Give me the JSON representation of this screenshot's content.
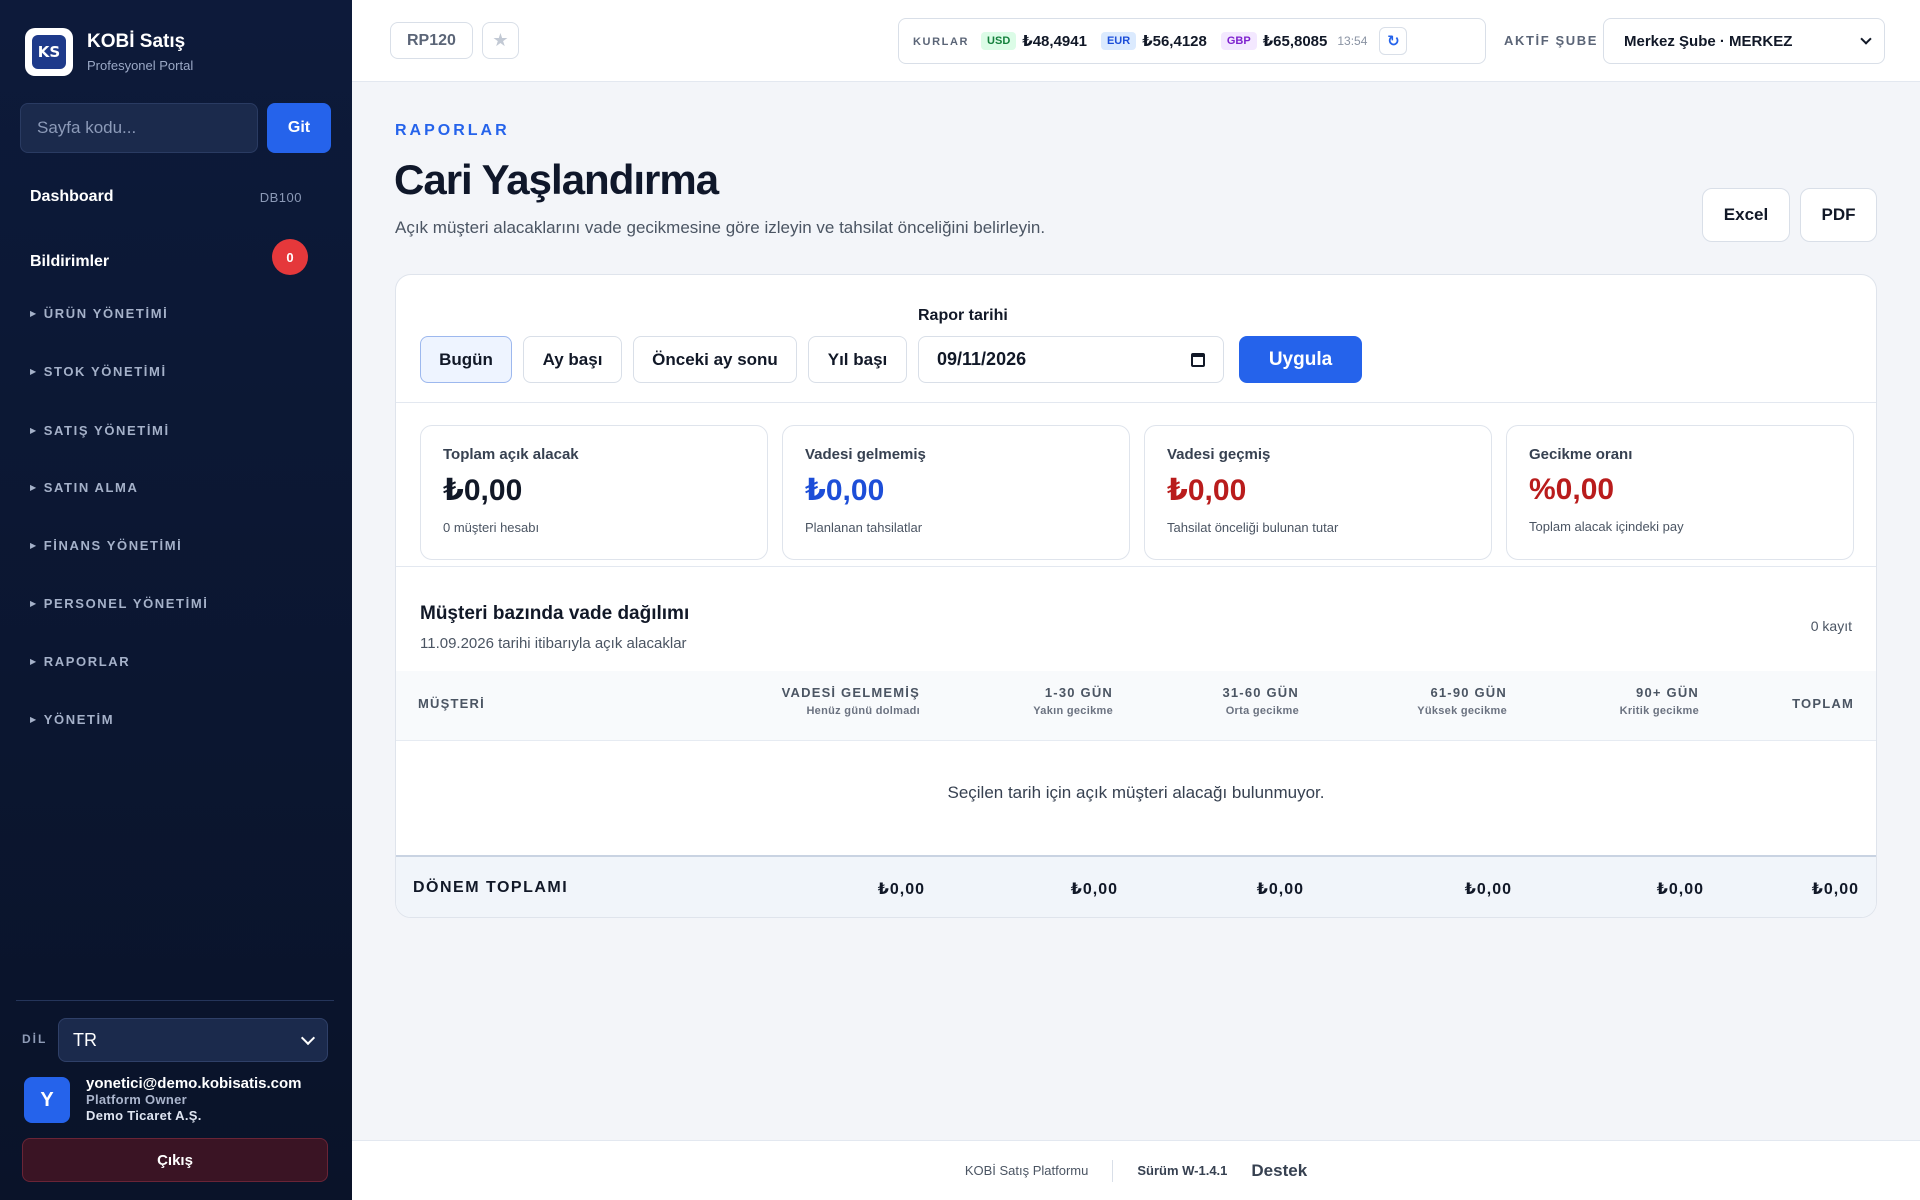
{
  "brand": {
    "name": "KOBİ Satış",
    "subtitle": "Profesyonel Portal",
    "logo_text": "KS"
  },
  "jump": {
    "placeholder": "Sayfa kodu...",
    "button": "Git"
  },
  "nav": {
    "dashboard": {
      "label": "Dashboard",
      "code": "DB100"
    },
    "notifications": {
      "label": "Bildirimler",
      "count": "0"
    },
    "groups": [
      "ÜRÜN YÖNETİMİ",
      "STOK YÖNETİMİ",
      "SATIŞ YÖNETİMİ",
      "SATIN ALMA",
      "FİNANS YÖNETİMİ",
      "PERSONEL YÖNETİMİ",
      "RAPORLAR",
      "YÖNETİM"
    ]
  },
  "lang": {
    "label": "DİL",
    "value": "TR"
  },
  "user": {
    "initial": "Y",
    "email": "yonetici@demo.kobisatis.com",
    "role": "Platform Owner",
    "company": "Demo Ticaret A.Ş."
  },
  "logout": "Çıkış",
  "topbar": {
    "page_code": "RP120",
    "rates_label": "KURLAR",
    "rates": [
      {
        "code": "USD",
        "value": "₺48,4941",
        "bg": "#dcfce7",
        "fg": "#15803d"
      },
      {
        "code": "EUR",
        "value": "₺56,4128",
        "bg": "#dbeafe",
        "fg": "#1d4ed8"
      },
      {
        "code": "GBP",
        "value": "₺65,8085",
        "bg": "#f3e8ff",
        "fg": "#7e22ce"
      }
    ],
    "rates_time": "13:54",
    "branch_label": "AKTİF ŞUBE",
    "branch_value": "Merkez Şube · MERKEZ"
  },
  "page": {
    "eyebrow": "RAPORLAR",
    "title": "Cari Yaşlandırma",
    "description": "Açık müşteri alacaklarını vade gecikmesine göre izleyin ve tahsilat önceliğini belirleyin.",
    "export_excel": "Excel",
    "export_pdf": "PDF"
  },
  "filters": {
    "quick": [
      "Bugün",
      "Ay başı",
      "Önceki ay sonu",
      "Yıl başı"
    ],
    "active_index": 0,
    "date_label": "Rapor tarihi",
    "date_value": "09/11/2026",
    "apply": "Uygula"
  },
  "kpis": [
    {
      "label": "Toplam açık alacak",
      "value": "₺0,00",
      "sub": "0 müşteri hesabı",
      "color": "#111827"
    },
    {
      "label": "Vadesi gelmemiş",
      "value": "₺0,00",
      "sub": "Planlanan tahsilatlar",
      "color": "#1d4ed8"
    },
    {
      "label": "Vadesi geçmiş",
      "value": "₺0,00",
      "sub": "Tahsilat önceliği bulunan tutar",
      "color": "#b91c1c"
    },
    {
      "label": "Gecikme oranı",
      "value": "%0,00",
      "sub": "Toplam alacak içindeki pay",
      "color": "#b91c1c"
    }
  ],
  "table": {
    "title": "Müşteri bazında vade dağılımı",
    "subtitle": "11.09.2026 tarihi itibarıyla açık alacaklar",
    "record_count": "0 kayıt",
    "columns": [
      {
        "label": "MÜŞTERİ",
        "sub": ""
      },
      {
        "label": "VADESİ GELMEMİŞ",
        "sub": "Henüz günü dolmadı"
      },
      {
        "label": "1-30 GÜN",
        "sub": "Yakın gecikme"
      },
      {
        "label": "31-60 GÜN",
        "sub": "Orta gecikme"
      },
      {
        "label": "61-90 GÜN",
        "sub": "Yüksek gecikme"
      },
      {
        "label": "90+ GÜN",
        "sub": "Kritik gecikme"
      },
      {
        "label": "TOPLAM",
        "sub": ""
      }
    ],
    "empty_message": "Seçilen tarih için açık müşteri alacağı bulunmuyor.",
    "footer_label": "DÖNEM TOPLAMI",
    "footer_values": [
      "₺0,00",
      "₺0,00",
      "₺0,00",
      "₺0,00",
      "₺0,00",
      "₺0,00"
    ]
  },
  "footer": {
    "brand": "KOBİ Satış Platformu",
    "version": "Sürüm W-1.4.1",
    "support": "Destek"
  }
}
